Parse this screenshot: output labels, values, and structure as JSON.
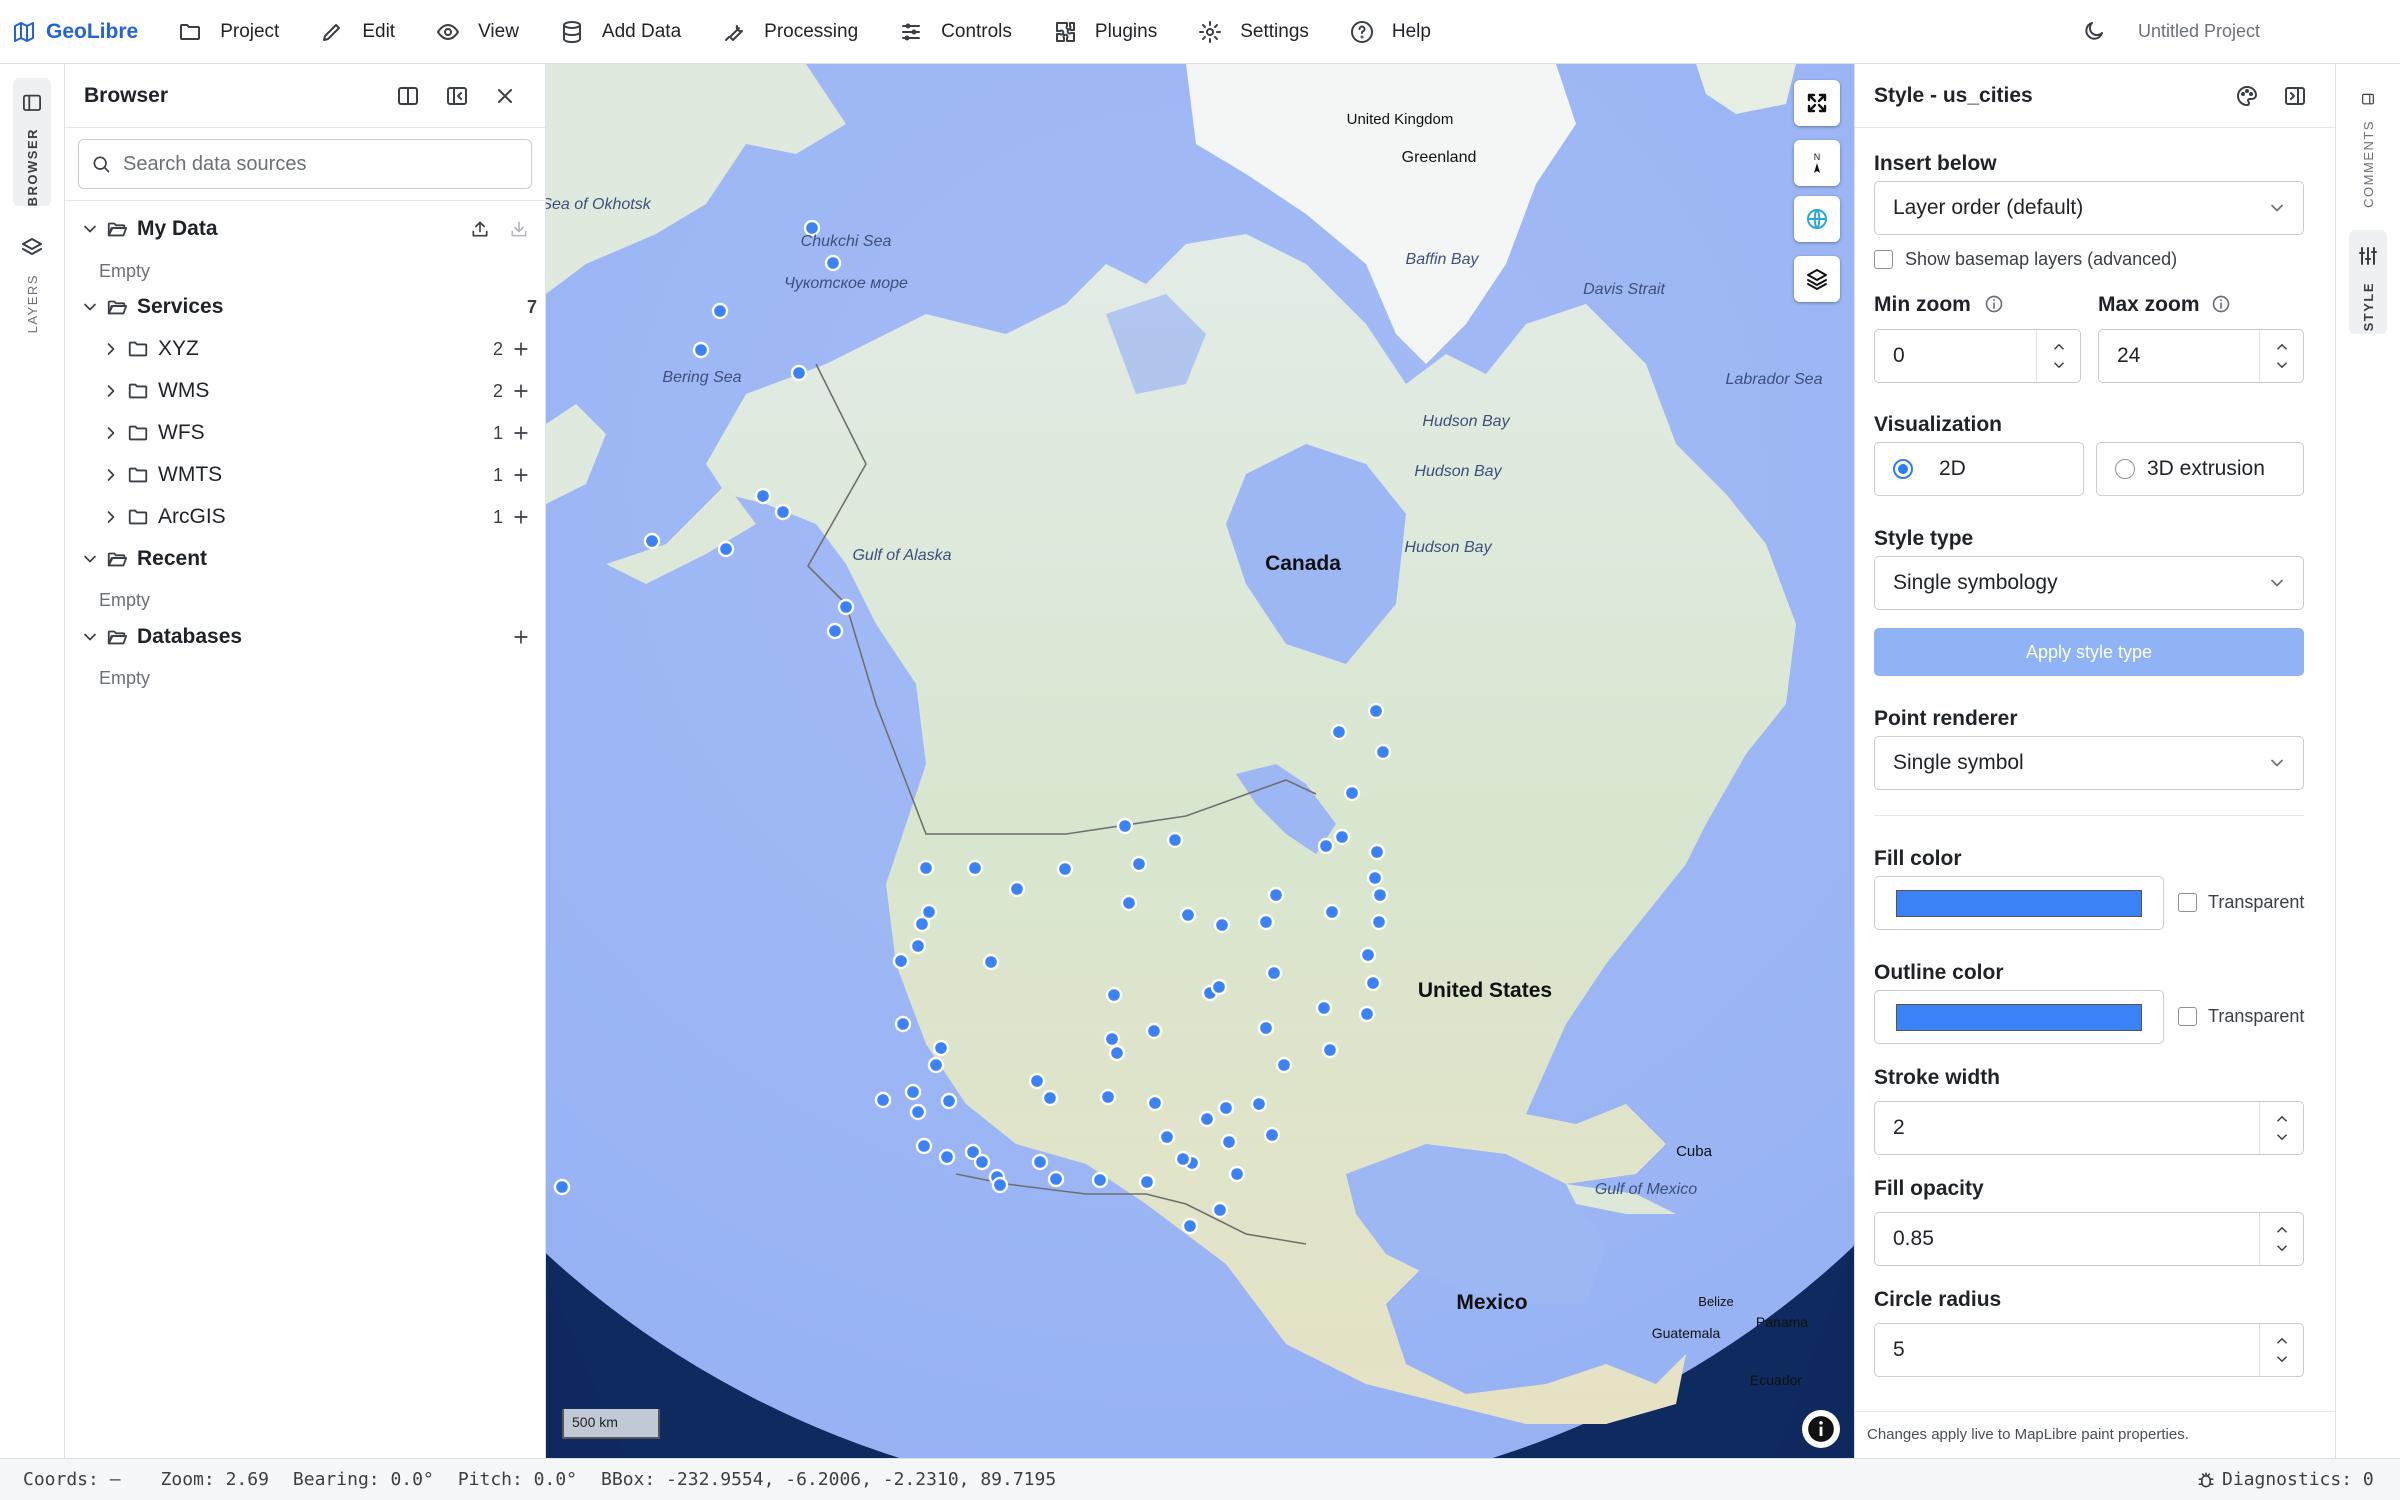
{
  "app": {
    "name": "GeoLibre",
    "project_title": "Untitled Project"
  },
  "menu": [
    {
      "label": "Project",
      "icon": "folder-icon"
    },
    {
      "label": "Edit",
      "icon": "pencil-icon"
    },
    {
      "label": "View",
      "icon": "eye-icon"
    },
    {
      "label": "Add Data",
      "icon": "database-icon"
    },
    {
      "label": "Processing",
      "icon": "wrench-icon"
    },
    {
      "label": "Controls",
      "icon": "sliders-icon"
    },
    {
      "label": "Plugins",
      "icon": "puzzle-icon"
    },
    {
      "label": "Settings",
      "icon": "gear-icon"
    },
    {
      "label": "Help",
      "icon": "help-icon"
    }
  ],
  "left_rail": {
    "browser": "BROWSER",
    "layers": "LAYERS"
  },
  "right_rail": {
    "comments": "COMMENTS",
    "style": "STYLE"
  },
  "browser": {
    "title": "Browser",
    "search_placeholder": "Search data sources",
    "my_data": {
      "label": "My Data",
      "empty": "Empty"
    },
    "services": {
      "label": "Services",
      "count": "7",
      "children": [
        {
          "label": "XYZ",
          "count": "2"
        },
        {
          "label": "WMS",
          "count": "2"
        },
        {
          "label": "WFS",
          "count": "1"
        },
        {
          "label": "WMTS",
          "count": "1"
        },
        {
          "label": "ArcGIS",
          "count": "1"
        }
      ]
    },
    "recent": {
      "label": "Recent",
      "empty": "Empty"
    },
    "databases": {
      "label": "Databases",
      "empty": "Empty"
    }
  },
  "map": {
    "scale_label": "500 km",
    "labels": {
      "greenland": "Greenland",
      "uk": "United Kingdom",
      "canada": "Canada",
      "us": "United States",
      "mexico": "Mexico",
      "cuba": "Cuba",
      "belize": "Belize",
      "guatemala": "Guatemala",
      "panama": "Panama",
      "ecuador": "Ecuador",
      "sea_okhotsk": "Sea of Okhotsk",
      "chukchi": "Chukchi Sea",
      "chukchi_ru": "Чукотское море",
      "bering": "Bering Sea",
      "alaska_gulf": "Gulf of Alaska",
      "baffin": "Baffin Bay",
      "davis": "Davis Strait",
      "labrador": "Labrador Sea",
      "hudson": "Hudson Bay",
      "mexico_gulf": "Gulf of Mexico"
    },
    "points_color": "#3b82f6"
  },
  "style_panel": {
    "title": "Style - us_cities",
    "insert_below": {
      "label": "Insert below",
      "value": "Layer order (default)"
    },
    "basemap_checkbox": "Show basemap layers (advanced)",
    "min_zoom": {
      "label": "Min zoom",
      "value": "0"
    },
    "max_zoom": {
      "label": "Max zoom",
      "value": "24"
    },
    "visualization": {
      "label": "Visualization",
      "opt_2d": "2D",
      "opt_3d": "3D extrusion",
      "selected": "2D"
    },
    "style_type": {
      "label": "Style type",
      "value": "Single symbology"
    },
    "apply_button": "Apply style type",
    "point_renderer": {
      "label": "Point renderer",
      "value": "Single symbol"
    },
    "fill_color": {
      "label": "Fill color",
      "value": "#3b82f6",
      "transparent_label": "Transparent"
    },
    "outline_color": {
      "label": "Outline color",
      "value": "#3b82f6",
      "transparent_label": "Transparent"
    },
    "stroke_width": {
      "label": "Stroke width",
      "value": "2"
    },
    "fill_opacity": {
      "label": "Fill opacity",
      "value": "0.85"
    },
    "circle_radius": {
      "label": "Circle radius",
      "value": "5"
    },
    "footer": "Changes apply live to MapLibre paint properties."
  },
  "status": {
    "coords": "Coords: —",
    "zoom": "Zoom: 2.69",
    "bearing": "Bearing: 0.0°",
    "pitch": "Pitch: 0.0°",
    "bbox": "BBox: -232.9554, -6.2006, -2.2310, 89.7195",
    "diagnostics": "Diagnostics: 0"
  }
}
